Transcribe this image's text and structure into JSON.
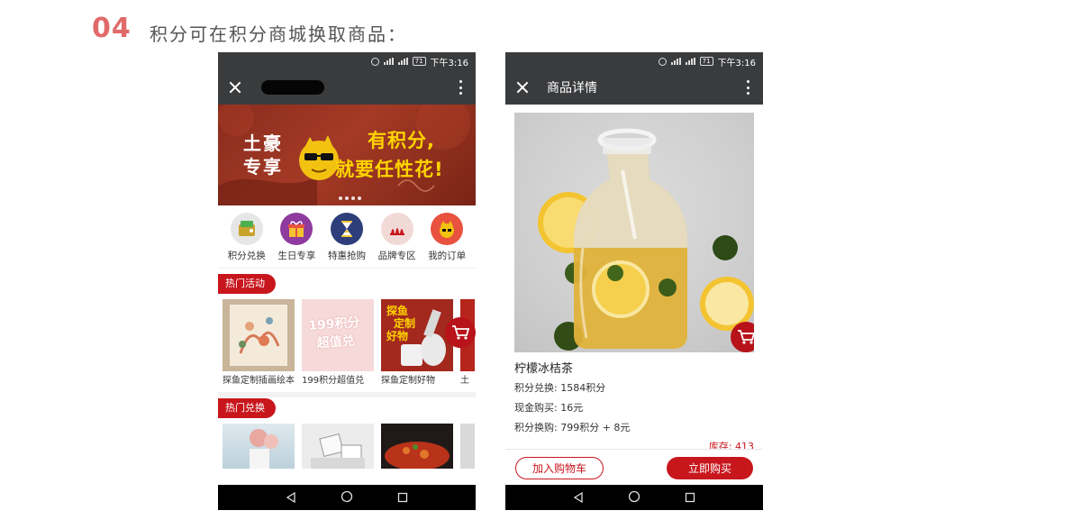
{
  "slide": {
    "number": "04",
    "title": "积分可在积分商城换取商品："
  },
  "colors": {
    "accent": "#c8161d",
    "number": "#e06a6a",
    "bar": "#3a3b3d"
  },
  "status_bar": {
    "time": "下午3:16",
    "battery": "71"
  },
  "left_screen": {
    "app_bar": {
      "title_redacted": true
    },
    "banner": {
      "left_text_1": "土豪",
      "left_text_2": "专享",
      "right_text_1": "有积分,",
      "right_text_2": "就要任性花!"
    },
    "categories": [
      {
        "label": "积分兑换",
        "icon": "wallet-icon"
      },
      {
        "label": "生日专享",
        "icon": "gift-icon"
      },
      {
        "label": "特惠抢购",
        "icon": "hourglass-icon"
      },
      {
        "label": "品牌专区",
        "icon": "brand-icon"
      },
      {
        "label": "我的订单",
        "icon": "mascot-icon"
      }
    ],
    "hot_activities": {
      "tag": "热门活动",
      "items": [
        {
          "name": "探鱼定制插画绘本",
          "image_text": ""
        },
        {
          "name": "199积分超值兑",
          "image_text_1": "199积分",
          "image_text_2": "超值兑"
        },
        {
          "name": "探鱼定制好物",
          "image_text_1": "探鱼",
          "image_text_2": "定制",
          "image_text_3": "好物"
        },
        {
          "name": "土"
        }
      ]
    },
    "hot_exchange": {
      "tag": "热门兑换"
    }
  },
  "right_screen": {
    "app_bar": {
      "title": "商品详情"
    },
    "product": {
      "name": "柠檬冰桔茶",
      "points_exchange": "积分兑换: 1584积分",
      "cash_price": "现金购买: 16元",
      "mixed_price": "积分换购: 799积分 + 8元",
      "stock": "库存: 413"
    },
    "buttons": {
      "add_to_cart": "加入购物车",
      "buy_now": "立即购买"
    }
  }
}
